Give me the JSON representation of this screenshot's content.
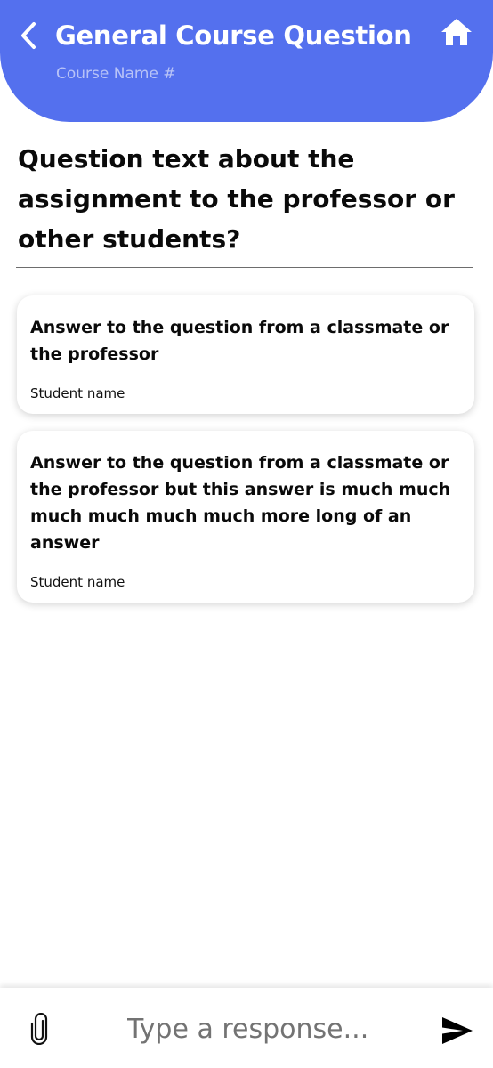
{
  "header": {
    "title": "General Course Question",
    "subtitle": "Course Name #",
    "back_icon": "chevron-left-icon",
    "home_icon": "home-icon",
    "color": "#5470ee"
  },
  "question": {
    "text": "Question text about the assignment to the professor or other students?"
  },
  "answers": [
    {
      "text": "Answer to the question from a classmate or the professor",
      "author": "Student name"
    },
    {
      "text": "Answer to the question from a classmate or the professor but this answer is much much much much much much more long of an answer",
      "author": "Student name"
    }
  ],
  "composer": {
    "placeholder": "Type a response...",
    "attach_icon": "paperclip-icon",
    "send_icon": "send-icon"
  }
}
